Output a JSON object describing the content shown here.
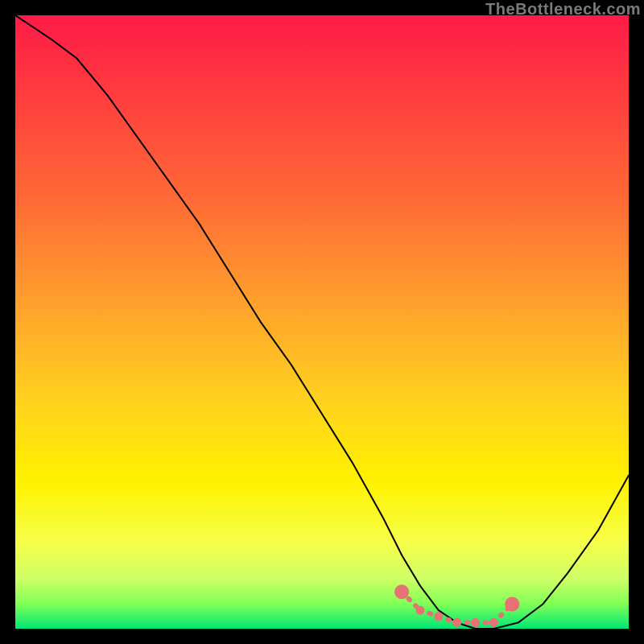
{
  "watermark": "TheBottleneck.com",
  "colors": {
    "gradient_top": "#ff1a47",
    "gradient_mid_orange": "#ff9a2e",
    "gradient_mid_yellow": "#fff200",
    "gradient_bottom": "#00e676",
    "curve": "#000000",
    "dots": "#e57373",
    "frame": "#000000"
  },
  "chart_data": {
    "type": "line",
    "title": "",
    "xlabel": "",
    "ylabel": "",
    "xlim": [
      0,
      100
    ],
    "ylim": [
      0,
      100
    ],
    "series": [
      {
        "name": "bottleneck-curve",
        "x": [
          0,
          3,
          6,
          10,
          15,
          20,
          25,
          30,
          35,
          40,
          45,
          50,
          55,
          60,
          63,
          66,
          69,
          72,
          75,
          78,
          82,
          86,
          90,
          95,
          100
        ],
        "values": [
          100,
          98,
          96,
          93,
          87,
          80,
          73,
          66,
          58,
          50,
          43,
          35,
          27,
          18,
          12,
          7,
          3,
          1,
          0,
          0,
          1,
          4,
          9,
          16,
          25
        ]
      }
    ],
    "highlight_points": {
      "name": "valley-dots",
      "x": [
        63,
        66,
        69,
        72,
        75,
        78,
        81
      ],
      "values": [
        6,
        3,
        2,
        1,
        1,
        1,
        4
      ]
    }
  }
}
